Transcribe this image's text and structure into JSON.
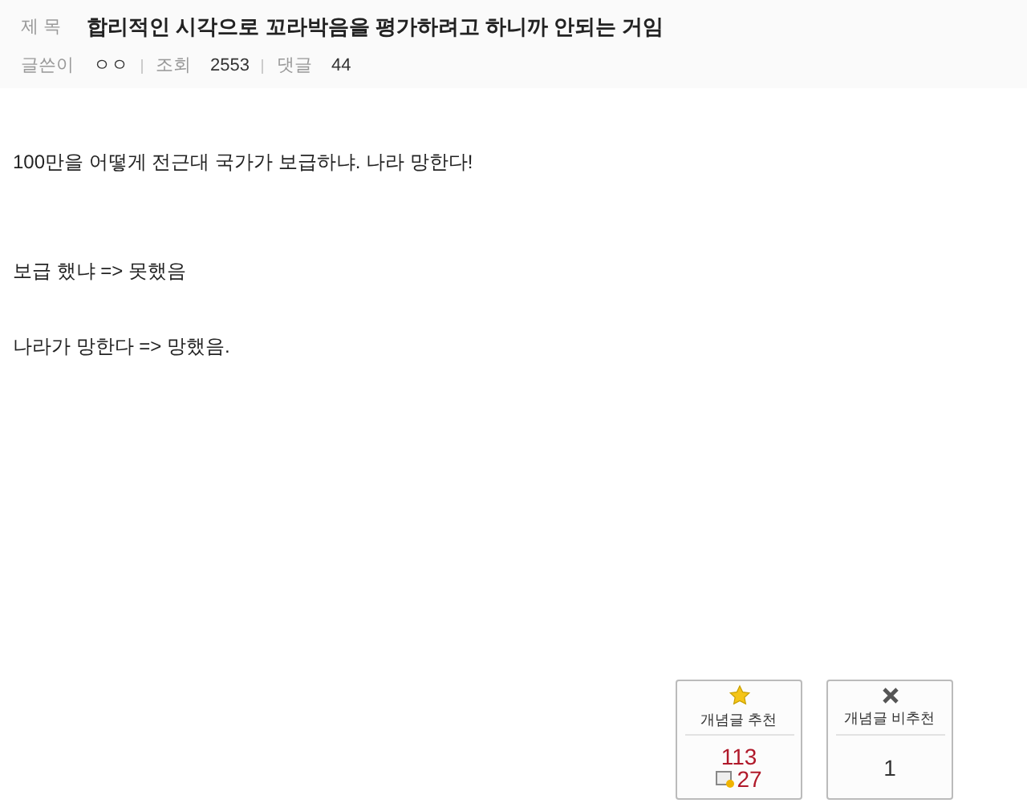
{
  "header": {
    "title_label": "제 목",
    "title": "합리적인 시각으로 꼬라박음을 평가하려고 하니까 안되는 거임",
    "meta": [
      {
        "label": "글쓴이",
        "value": "ㅇㅇ"
      },
      {
        "label": "조회",
        "value": "2553"
      },
      {
        "label": "댓글",
        "value": "44"
      }
    ]
  },
  "body": [
    "100만을 어떻게 전근대 국가가 보급하냐. 나라 망한다!",
    "보급 했냐 => 못했음",
    "나라가 망한다 => 망했음."
  ],
  "votes": [
    {
      "kind": "up",
      "label": "개념글 추천",
      "count": "113",
      "sub_count": "27"
    },
    {
      "kind": "down",
      "label": "개념글 비추천",
      "count": "1"
    }
  ]
}
